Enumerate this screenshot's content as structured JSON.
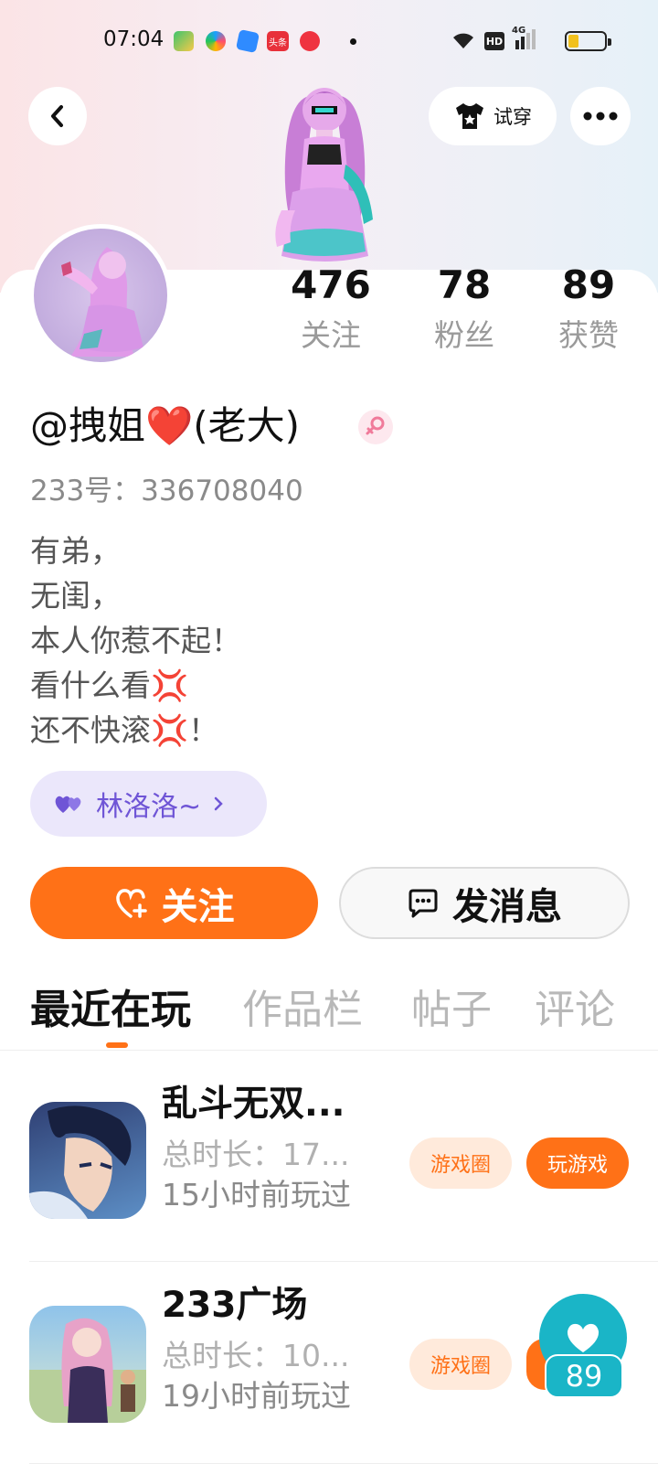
{
  "status_bar": {
    "time": "07:04",
    "app_icons": [
      "video-app-icon",
      "swirl-app-icon",
      "blue-app-icon",
      "toutiao-app-icon",
      "red-app-icon"
    ],
    "toutiao_label": "头条",
    "hd_label": "HD",
    "network_label": "4G",
    "battery_level": 0.3
  },
  "header": {
    "try_on_label": "试穿"
  },
  "profile": {
    "stats": [
      {
        "value": "476",
        "label": "关注"
      },
      {
        "value": "78",
        "label": "粉丝"
      },
      {
        "value": "89",
        "label": "获赞"
      }
    ],
    "name": "@拽姐❤️(老大)",
    "gender": "female",
    "uid": "233号：336708040",
    "bio_lines": [
      "有弟，",
      "无闺，",
      "本人你惹不起！",
      "看什么看💢",
      "还不快滚💢！"
    ],
    "cp_tag": "林洛洛~"
  },
  "actions": {
    "follow_label": "关注",
    "message_label": "发消息"
  },
  "tabs": [
    {
      "label": "最近在玩",
      "active": true
    },
    {
      "label": "作品栏",
      "active": false
    },
    {
      "label": "帖子",
      "active": false
    },
    {
      "label": "评论",
      "active": false
    }
  ],
  "games": [
    {
      "title": "乱斗无双...",
      "duration": "总时长：17...",
      "last_played": "15小时前玩过",
      "circle_label": "游戏圈",
      "play_label": "玩游戏"
    },
    {
      "title": "233广场",
      "duration": "总时长：10...",
      "last_played": "19小时前玩过",
      "circle_label": "游戏圈"
    }
  ],
  "like_float": {
    "count": "89"
  },
  "colors": {
    "accent": "#ff7117",
    "cp_tag_bg": "#ebe7fb",
    "cp_tag_text": "#6f55d6",
    "like_float": "#1ab5c7"
  }
}
